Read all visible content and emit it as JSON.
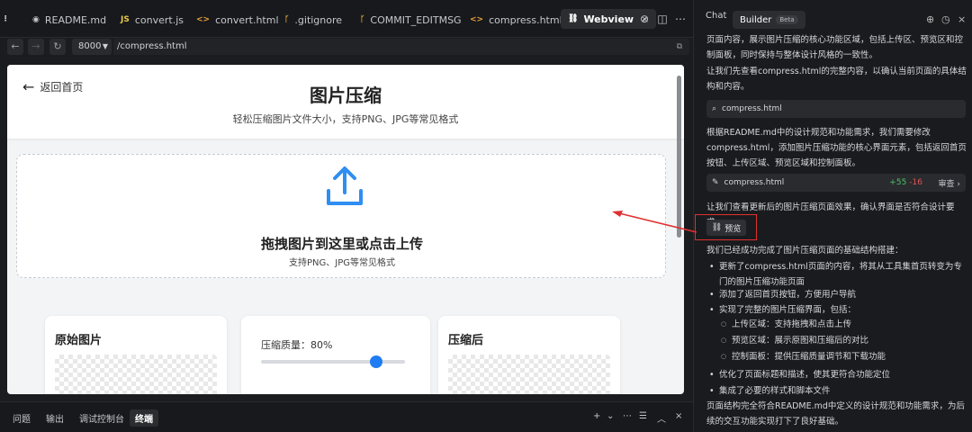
{
  "editor": {
    "tabs": [
      {
        "icon": "github-icon",
        "label": "README.md"
      },
      {
        "icon": "js-icon",
        "label": "convert.js"
      },
      {
        "icon": "html-icon",
        "label": "convert.html"
      },
      {
        "icon": "git-icon",
        "label": ".gitignore"
      },
      {
        "icon": "git-icon",
        "label": "COMMIT_EDITMSG"
      },
      {
        "icon": "html-icon",
        "label": "compress.html"
      }
    ],
    "active_tab": {
      "label": "Webview",
      "close": "×"
    },
    "address": {
      "port": "8000",
      "url": "/compress.html"
    }
  },
  "webview": {
    "back_label": "返回首页",
    "title": "图片压缩",
    "subtitle": "轻松压缩图片文件大小，支持PNG、JPG等常见格式",
    "drop_title": "拖拽图片到这里或点击上传",
    "drop_subtitle": "支持PNG、JPG等常见格式",
    "original_title": "原始图片",
    "quality_label": "压缩质量：80%",
    "quality_value": 0.8,
    "compressed_title": "压缩后",
    "accent_color": "#1f7cf2"
  },
  "bottom_panel": {
    "tabs": [
      "问题",
      "输出",
      "调试控制台",
      "终端"
    ],
    "active": "终端"
  },
  "chat": {
    "tabs": {
      "chat": "Chat",
      "builder": "Builder",
      "beta": "Beta"
    },
    "para1": "页面内容，展示图片压缩的核心功能区域，包括上传区、预览区和控制面板，同时保持与整体设计风格的一致性。",
    "para2": "让我们先查看compress.html的完整内容，以确认当前页面的具体结构和内容。",
    "chip1": "compress.html",
    "para3": "根据README.md中的设计规范和功能需求，我们需要修改compress.html，添加图片压缩功能的核心界面元素，包括返回首页按钮、上传区域、预览区域和控制面板。",
    "chip2": {
      "file": "compress.html",
      "added": "+55",
      "removed": "-16",
      "review": "审查"
    },
    "para4": "让我们查看更新后的图片压缩页面效果，确认界面是否符合设计要求。",
    "preview_btn": "预览",
    "para5": "我们已经成功完成了图片压缩页面的基础结构搭建：",
    "bullets": [
      "更新了compress.html页面的内容，将其从工具集首页转变为专门的图片压缩功能页面",
      "添加了返回首页按钮，方便用户导航",
      "实现了完整的图片压缩界面，包括："
    ],
    "sub_bullets": [
      "上传区域：支持拖拽和点击上传",
      "预览区域：展示原图和压缩后的对比",
      "控制面板：提供压缩质量调节和下载功能"
    ],
    "bullets2": [
      "优化了页面标题和描述，使其更符合功能定位",
      "集成了必要的样式和脚本文件"
    ],
    "para6": "页面结构完全符合README.md中定义的设计规范和功能需求，为后续的交互功能实现打下了良好基础。"
  }
}
